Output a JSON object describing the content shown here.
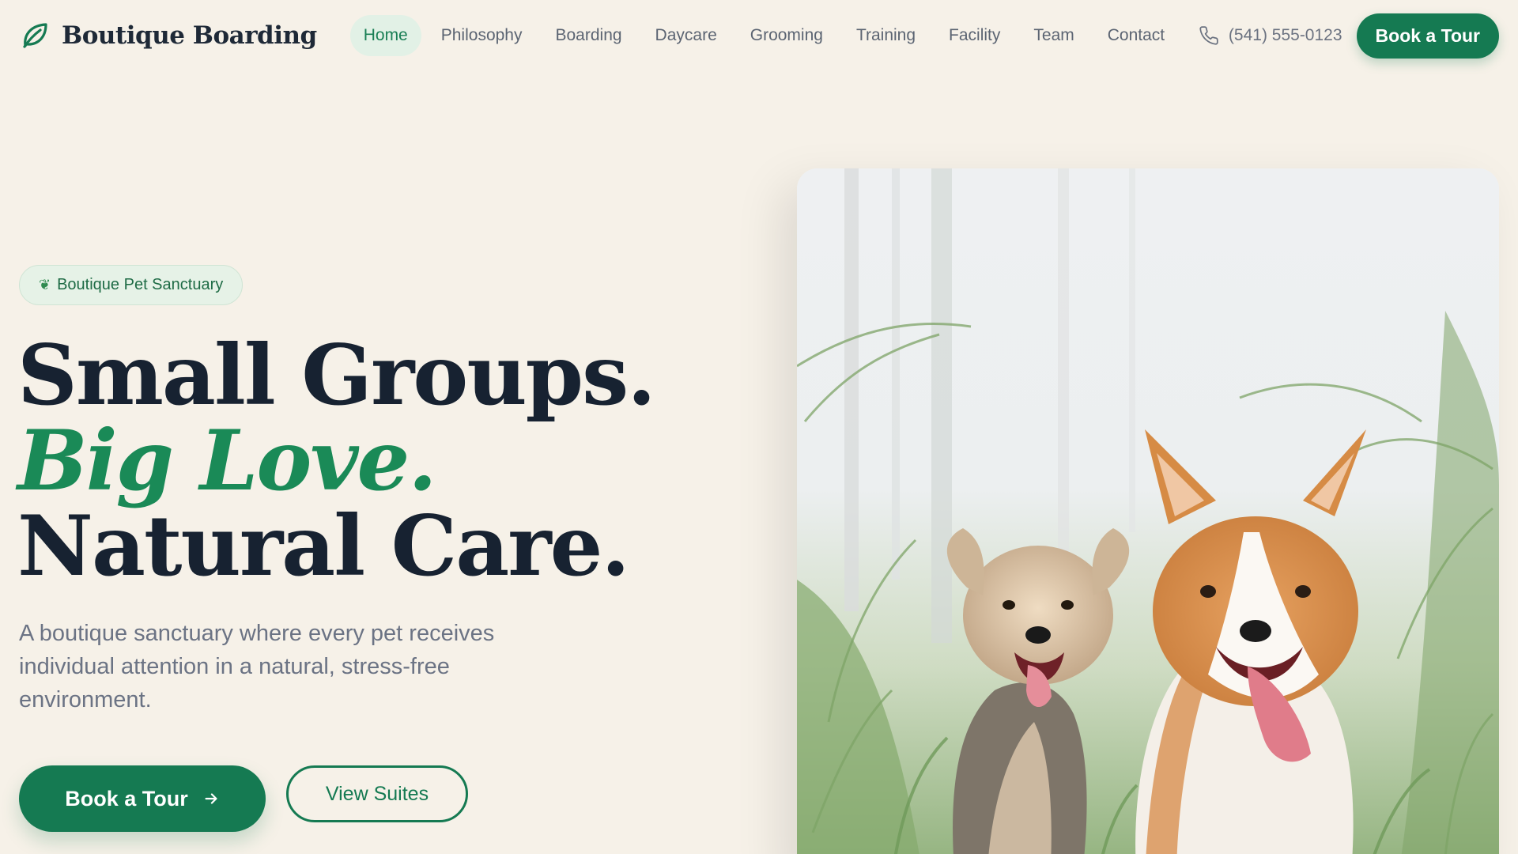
{
  "brand": {
    "name": "Boutique Boarding"
  },
  "nav": {
    "items": [
      {
        "label": "Home",
        "active": true
      },
      {
        "label": "Philosophy"
      },
      {
        "label": "Boarding"
      },
      {
        "label": "Daycare"
      },
      {
        "label": "Grooming"
      },
      {
        "label": "Training"
      },
      {
        "label": "Facility"
      },
      {
        "label": "Team"
      },
      {
        "label": "Contact"
      }
    ],
    "phone": "(541) 555-0123",
    "cta": "Book a Tour"
  },
  "hero": {
    "badge": "Boutique Pet Sanctuary",
    "headline": {
      "line1": "Small Groups.",
      "line2": "Big Love.",
      "line3": "Natural Care."
    },
    "subtitle": "A boutique sanctuary where every pet receives individual attention in a natural, stress-free environment.",
    "primary_cta": "Book a Tour",
    "secondary_cta": "View Suites",
    "image_alt": "Two happy dogs, a terrier and a corgi, standing in tall grass"
  },
  "colors": {
    "brand_green": "#157a52",
    "background": "#f6f1e8",
    "heading": "#172231",
    "accent_green": "#1a8a57"
  },
  "icons": {
    "logo": "leaf-icon",
    "phone": "phone-icon",
    "badge": "herb-icon",
    "arrow": "arrow-right-icon"
  }
}
